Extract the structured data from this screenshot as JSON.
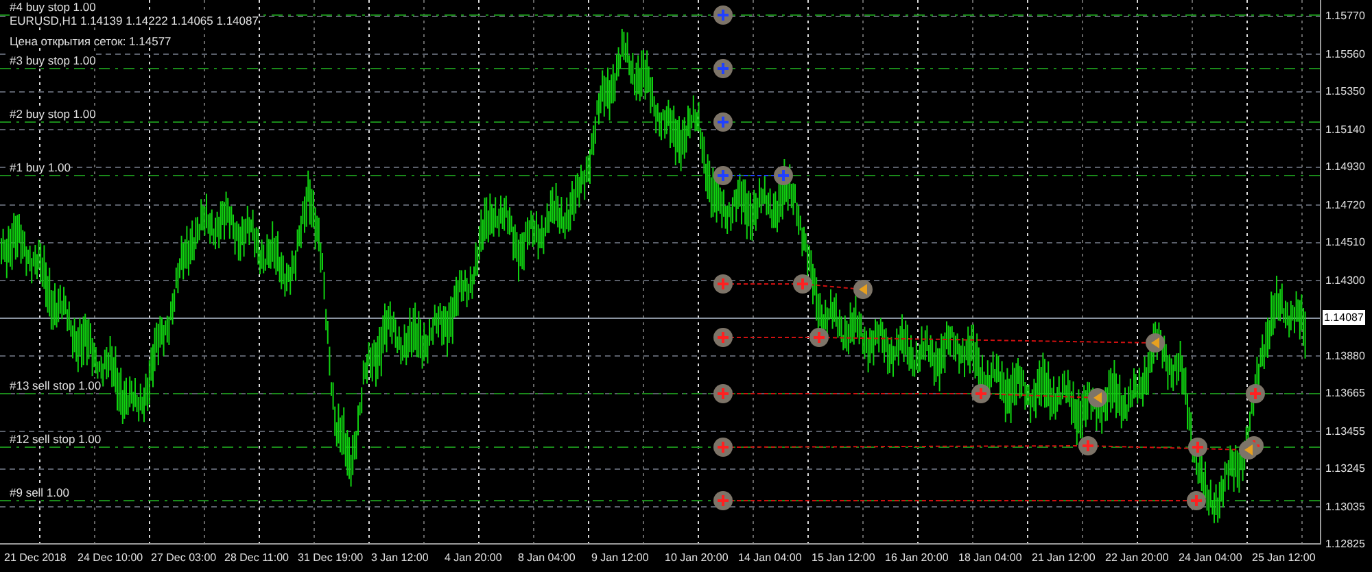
{
  "chart": {
    "symbol_line": "EURUSD,H1  1.14139 1.14222 1.14065 1.14087",
    "grid_open_price": "Цена открытия сеток: 1.14577",
    "order_labels": [
      "#4 buy stop 1.00",
      "#3 buy stop 1.00",
      "#2 buy stop 1.00",
      "#1 buy 1.00",
      "#13 sell stop 1.00",
      "#12 sell stop 1.00",
      "#9 sell 1.00"
    ],
    "price_axis": [
      {
        "kind": "tick",
        "label": "1.15770"
      },
      {
        "kind": "tick",
        "label": "1.15560"
      },
      {
        "kind": "tick",
        "label": "1.15350"
      },
      {
        "kind": "tick",
        "label": "1.15140"
      },
      {
        "kind": "tick",
        "label": "1.14930"
      },
      {
        "kind": "tick",
        "label": "1.14720"
      },
      {
        "kind": "tick",
        "label": "1.14510"
      },
      {
        "kind": "tick",
        "label": "1.14300"
      },
      {
        "kind": "current",
        "label": "1.14087"
      },
      {
        "kind": "tick",
        "label": "1.13880"
      },
      {
        "kind": "tick",
        "label": "1.13665"
      },
      {
        "kind": "tick",
        "label": "1.13455"
      },
      {
        "kind": "tick",
        "label": "1.13245"
      },
      {
        "kind": "tick",
        "label": "1.13035"
      },
      {
        "kind": "tick",
        "label": "1.12825"
      }
    ],
    "time_axis": [
      "21 Dec 2018",
      "24 Dec 10:00",
      "27 Dec 03:00",
      "28 Dec 11:00",
      "31 Dec 19:00",
      "3 Jan 12:00",
      "4 Jan 20:00",
      "8 Jan 04:00",
      "9 Jan 12:00",
      "10 Jan 20:00",
      "14 Jan 04:00",
      "15 Jan 12:00",
      "16 Jan 20:00",
      "18 Jan 04:00",
      "21 Jan 12:00",
      "22 Jan 20:00",
      "24 Jan 04:00",
      "25 Jan 12:00"
    ]
  }
}
